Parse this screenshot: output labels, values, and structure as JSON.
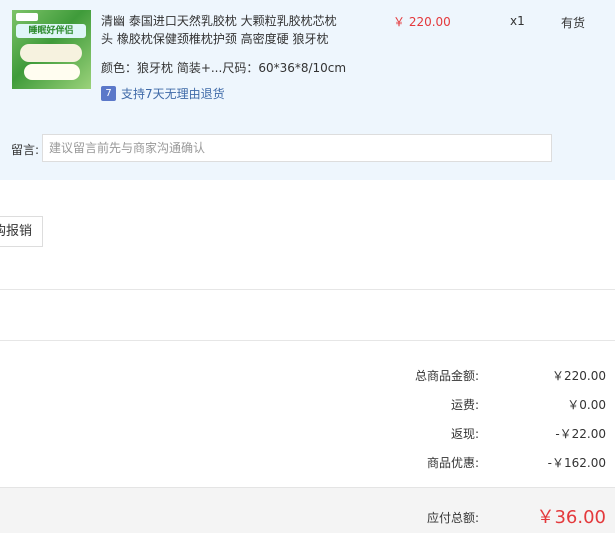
{
  "product": {
    "title": "清幽 泰国进口天然乳胶枕 大颗粒乳胶枕芯枕头 橡胶枕保健颈椎枕护颈 高密度硬 狼牙枕",
    "image_text": "睡眠好伴侣",
    "attributes": "颜色：狼牙枕 简装+...尺码：60*36*8/10cm",
    "guarantee_badge": "7",
    "guarantee_text": "支持7天无理由退货",
    "price": "￥ 220.00",
    "quantity": "x1",
    "stock_status": "有货"
  },
  "note": {
    "label": "留言:",
    "placeholder": "建议留言前先与商家沟通确认"
  },
  "reimburse_button": "购报销",
  "summary": [
    {
      "label": "总商品金额:",
      "value": "￥220.00"
    },
    {
      "label": "运费:",
      "value": "￥0.00"
    },
    {
      "label": "返现:",
      "value": "-￥22.00"
    },
    {
      "label": "商品优惠:",
      "value": "-￥162.00"
    }
  ],
  "total": {
    "label": "应付总额:",
    "value": "￥36.00"
  },
  "colors": {
    "panel_bg": "#eef6fd",
    "price_red": "#e4393c",
    "guarantee_blue": "#3f6aa8"
  }
}
